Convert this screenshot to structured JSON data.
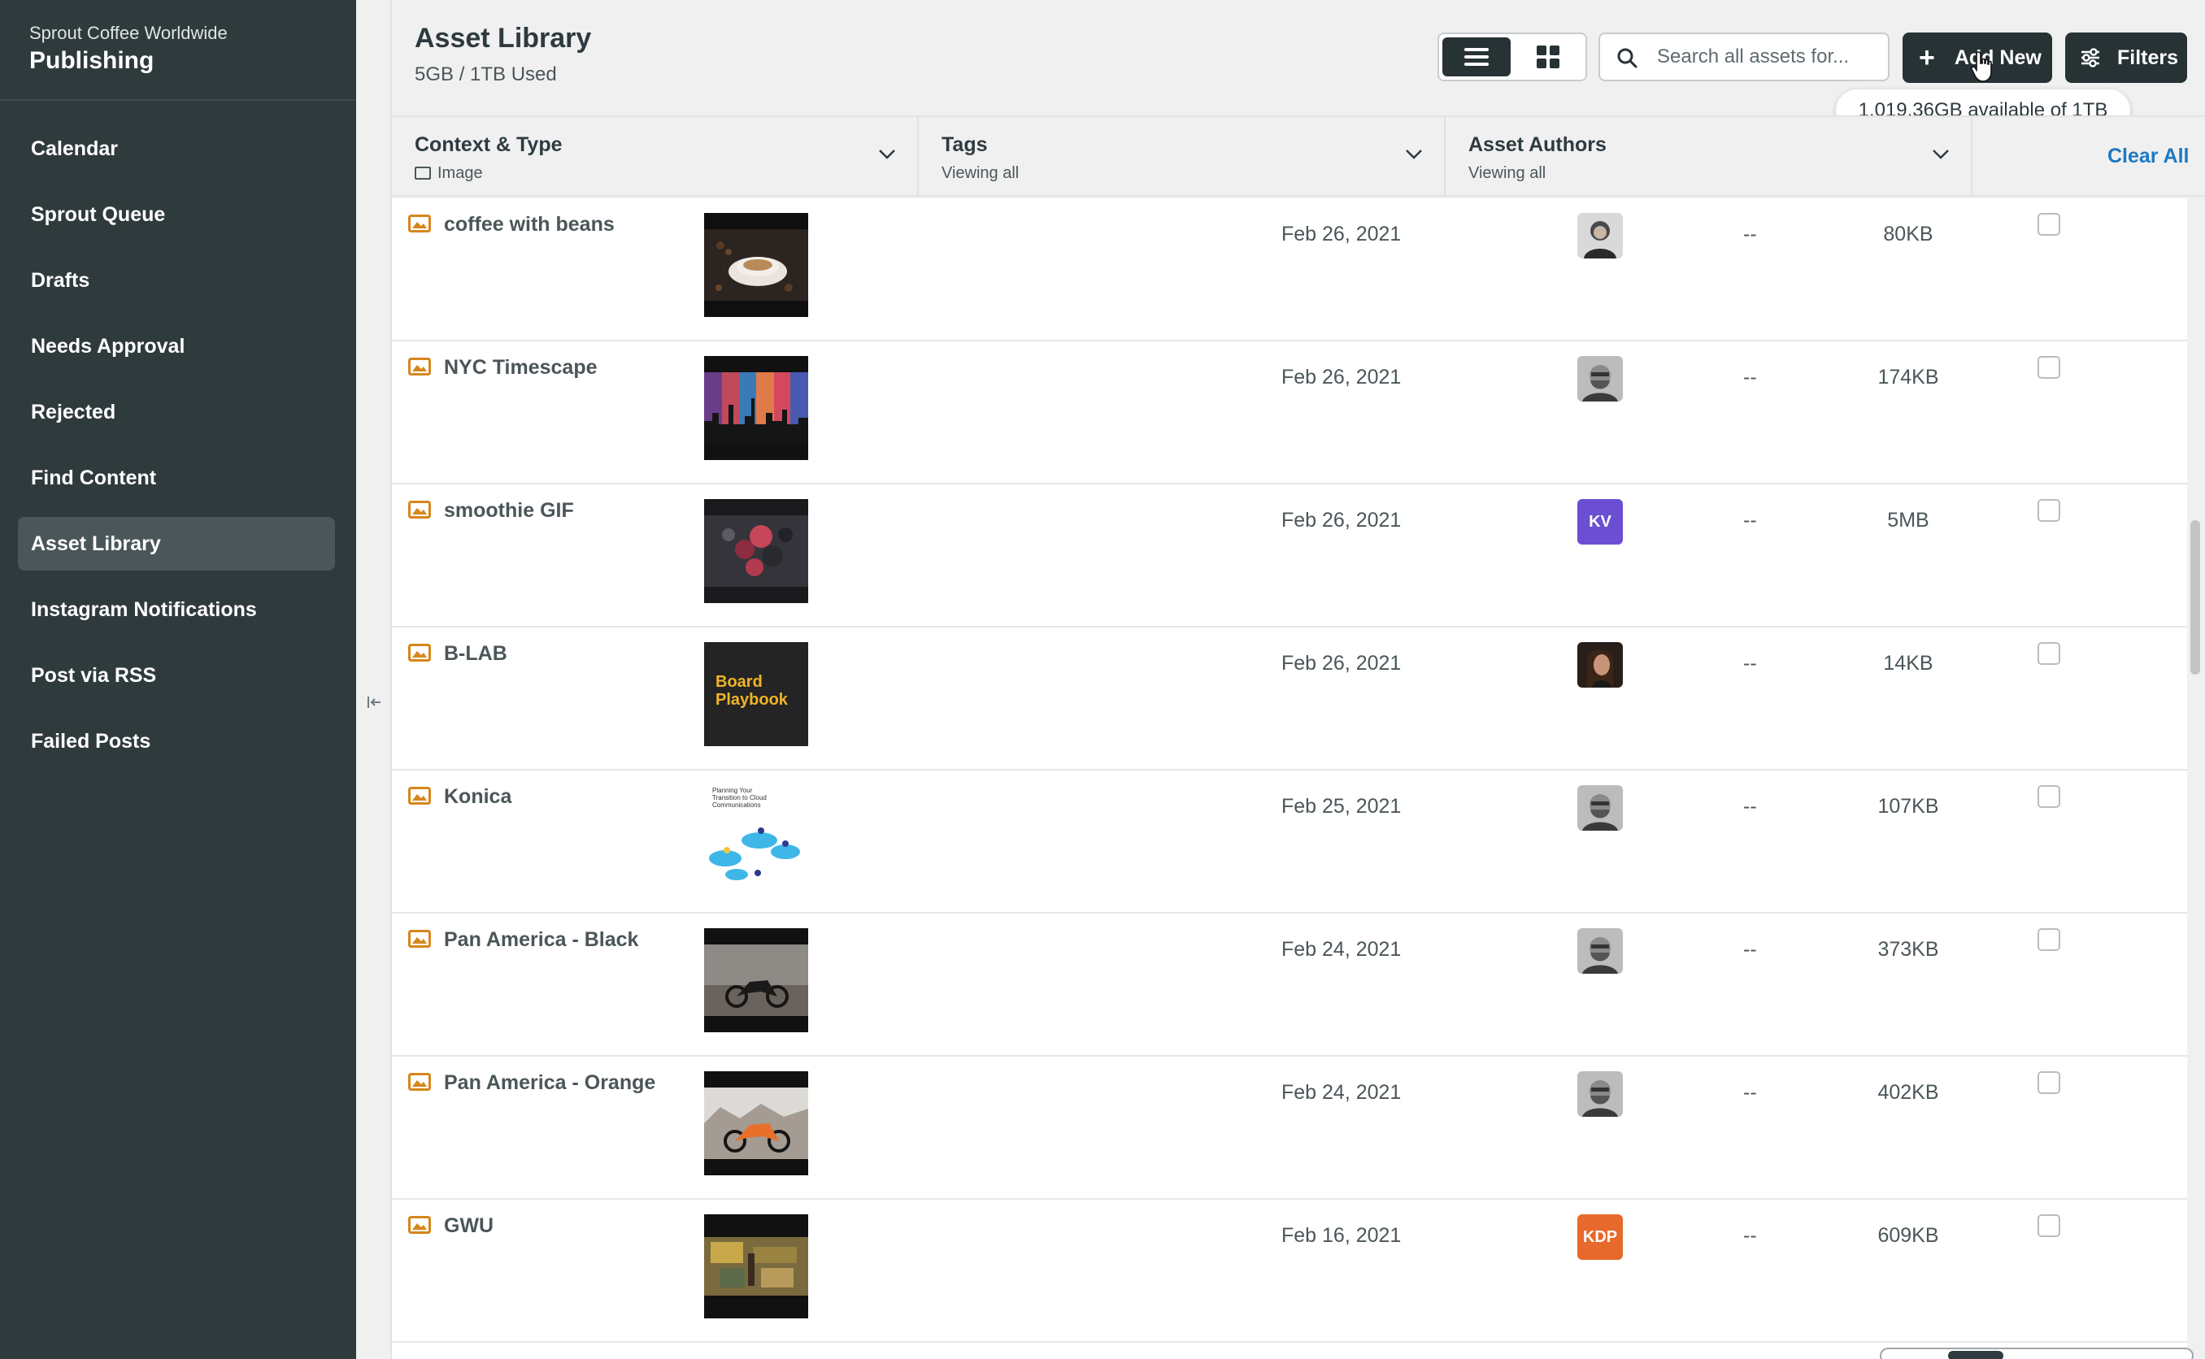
{
  "sidebar": {
    "org": "Sprout Coffee Worldwide",
    "app": "Publishing",
    "items": [
      {
        "label": "Calendar"
      },
      {
        "label": "Sprout Queue"
      },
      {
        "label": "Drafts"
      },
      {
        "label": "Needs Approval"
      },
      {
        "label": "Rejected"
      },
      {
        "label": "Find Content"
      },
      {
        "label": "Asset Library",
        "active": true
      },
      {
        "label": "Instagram Notifications"
      },
      {
        "label": "Post via RSS"
      },
      {
        "label": "Failed Posts"
      }
    ]
  },
  "header": {
    "title": "Asset Library",
    "storage": "5GB / 1TB Used",
    "search_placeholder": "Search all assets for...",
    "add_label": "Add New",
    "filters_label": "Filters",
    "tooltip": "1,019.36GB available of 1TB",
    "view_mode": "list"
  },
  "filters": {
    "context": {
      "title": "Context & Type",
      "sub": "Image"
    },
    "tags": {
      "title": "Tags",
      "sub": "Viewing all"
    },
    "authors": {
      "title": "Asset Authors",
      "sub": "Viewing all"
    },
    "clear_all": "Clear All"
  },
  "colors": {
    "sidebar_bg": "#2f3a3d",
    "accent_link": "#1d79c2",
    "image_icon": "#d6861c",
    "avatar_kv": "#6a4fd3",
    "avatar_kdp": "#e8692c"
  },
  "rows": [
    {
      "name": "coffee with beans",
      "date": "Feb 26, 2021",
      "author": "photo",
      "size": "80KB",
      "dash": "--"
    },
    {
      "name": "NYC Timescape",
      "date": "Feb 26, 2021",
      "author": "photo",
      "size": "174KB",
      "dash": "--"
    },
    {
      "name": "smoothie GIF",
      "date": "Feb 26, 2021",
      "author": "KV",
      "size": "5MB",
      "dash": "--"
    },
    {
      "name": "B-LAB",
      "date": "Feb 26, 2021",
      "author": "photo",
      "size": "14KB",
      "dash": "--",
      "thumb_text": "Board Playbook"
    },
    {
      "name": "Konica",
      "date": "Feb 25, 2021",
      "author": "photo",
      "size": "107KB",
      "dash": "--",
      "thumb_text": "Planning Your Transition to Cloud Communications"
    },
    {
      "name": "Pan America - Black",
      "date": "Feb 24, 2021",
      "author": "photo",
      "size": "373KB",
      "dash": "--"
    },
    {
      "name": "Pan America - Orange",
      "date": "Feb 24, 2021",
      "author": "photo",
      "size": "402KB",
      "dash": "--"
    },
    {
      "name": "GWU",
      "date": "Feb 16, 2021",
      "author": "KDP",
      "size": "609KB",
      "dash": "--"
    }
  ]
}
